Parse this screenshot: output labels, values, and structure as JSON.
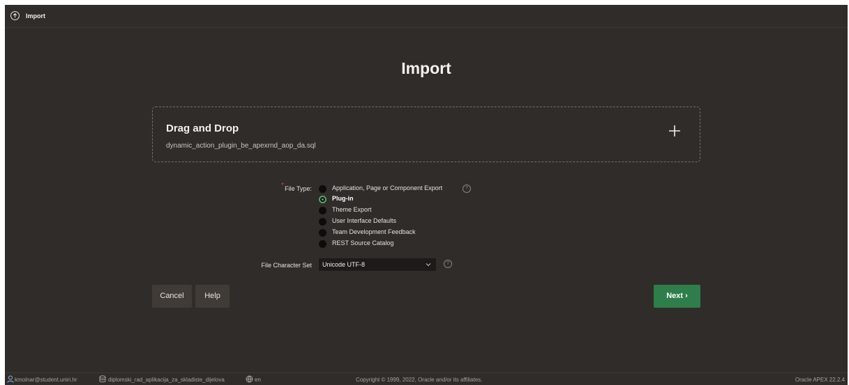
{
  "header": {
    "title": "Import",
    "icon": "upload-circle-icon"
  },
  "page": {
    "title": "Import"
  },
  "dropzone": {
    "title": "Drag and Drop",
    "filename": "dynamic_action_plugin_be_apexrnd_aop_da.sql",
    "icon": "plus-icon"
  },
  "file_type": {
    "label": "File Type:",
    "required": "*",
    "options": [
      {
        "label": "Application, Page or Component Export",
        "selected": false
      },
      {
        "label": "Plug-in",
        "selected": true
      },
      {
        "label": "Theme Export",
        "selected": false
      },
      {
        "label": "User Interface Defaults",
        "selected": false
      },
      {
        "label": "Team Development Feedback",
        "selected": false
      },
      {
        "label": "REST Source Catalog",
        "selected": false
      }
    ],
    "help": "?"
  },
  "char_set": {
    "label": "File Character Set",
    "value": "Unicode UTF-8",
    "help": "?"
  },
  "buttons": {
    "cancel": "Cancel",
    "help": "Help",
    "next": "Next ›"
  },
  "footer": {
    "user": "kmolnar@student.uniri.hr",
    "workspace": "diplomski_rad_aplikacija_za_skladiste_dijelova",
    "language": "en",
    "copyright": "Copyright © 1999, 2022, Oracle and/or its affiliates.",
    "version": "Oracle APEX 22.2.4"
  },
  "colors": {
    "background": "#302c29",
    "accent": "#2f7d4b",
    "selected_radio": "#58a468",
    "required": "#d7463c"
  }
}
